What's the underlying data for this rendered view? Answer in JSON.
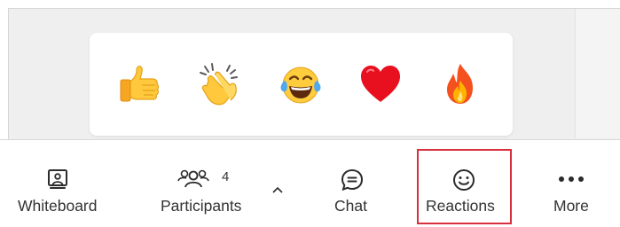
{
  "reactions": {
    "items": [
      {
        "name": "thumbs-up",
        "glyph": "👍"
      },
      {
        "name": "clapping-hands",
        "glyph": "👏"
      },
      {
        "name": "tears-of-joy",
        "glyph": "😂"
      },
      {
        "name": "red-heart",
        "glyph": "❤️"
      },
      {
        "name": "fire",
        "glyph": "🔥"
      }
    ]
  },
  "toolbar": {
    "whiteboard_label": "Whiteboard",
    "participants_label": "Participants",
    "participants_count": "4",
    "chat_label": "Chat",
    "reactions_label": "Reactions",
    "more_label": "More"
  },
  "colors": {
    "highlight": "#d9303e",
    "icon": "#2b2b2b"
  }
}
